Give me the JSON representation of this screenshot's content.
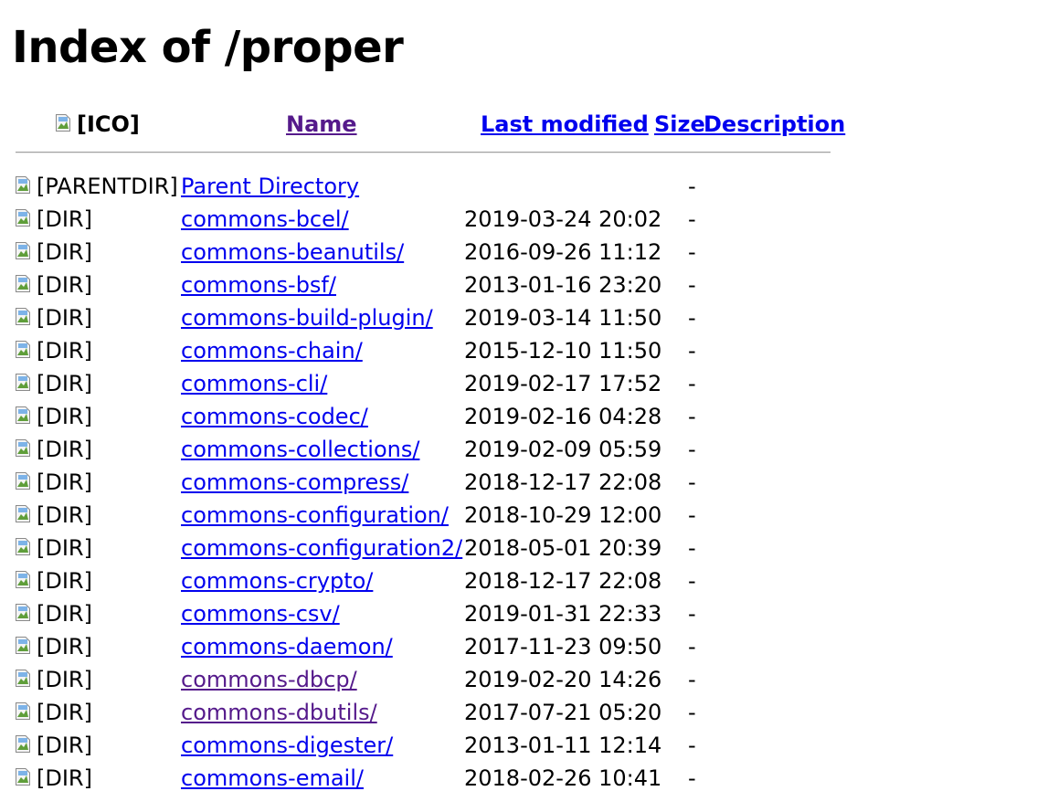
{
  "page_title": "Index of /proper",
  "columns": {
    "icon": "[ICO]",
    "name": "Name",
    "last_modified": "Last modified",
    "size": "Size",
    "description": "Description"
  },
  "entries": [
    {
      "alt": "[PARENTDIR]",
      "name": "Parent Directory",
      "date": "",
      "size": "-",
      "visited": false
    },
    {
      "alt": "[DIR]",
      "name": "commons-bcel/",
      "date": "2019-03-24 20:02",
      "size": "-",
      "visited": false
    },
    {
      "alt": "[DIR]",
      "name": "commons-beanutils/",
      "date": "2016-09-26 11:12",
      "size": "-",
      "visited": false
    },
    {
      "alt": "[DIR]",
      "name": "commons-bsf/",
      "date": "2013-01-16 23:20",
      "size": "-",
      "visited": false
    },
    {
      "alt": "[DIR]",
      "name": "commons-build-plugin/",
      "date": "2019-03-14 11:50",
      "size": "-",
      "visited": false
    },
    {
      "alt": "[DIR]",
      "name": "commons-chain/",
      "date": "2015-12-10 11:50",
      "size": "-",
      "visited": false
    },
    {
      "alt": "[DIR]",
      "name": "commons-cli/",
      "date": "2019-02-17 17:52",
      "size": "-",
      "visited": false
    },
    {
      "alt": "[DIR]",
      "name": "commons-codec/",
      "date": "2019-02-16 04:28",
      "size": "-",
      "visited": false
    },
    {
      "alt": "[DIR]",
      "name": "commons-collections/",
      "date": "2019-02-09 05:59",
      "size": "-",
      "visited": false
    },
    {
      "alt": "[DIR]",
      "name": "commons-compress/",
      "date": "2018-12-17 22:08",
      "size": "-",
      "visited": false
    },
    {
      "alt": "[DIR]",
      "name": "commons-configuration/",
      "date": "2018-10-29 12:00",
      "size": "-",
      "visited": false
    },
    {
      "alt": "[DIR]",
      "name": "commons-configuration2/",
      "date": "2018-05-01 20:39",
      "size": "-",
      "visited": false
    },
    {
      "alt": "[DIR]",
      "name": "commons-crypto/",
      "date": "2018-12-17 22:08",
      "size": "-",
      "visited": false
    },
    {
      "alt": "[DIR]",
      "name": "commons-csv/",
      "date": "2019-01-31 22:33",
      "size": "-",
      "visited": false
    },
    {
      "alt": "[DIR]",
      "name": "commons-daemon/",
      "date": "2017-11-23 09:50",
      "size": "-",
      "visited": false
    },
    {
      "alt": "[DIR]",
      "name": "commons-dbcp/",
      "date": "2019-02-20 14:26",
      "size": "-",
      "visited": true
    },
    {
      "alt": "[DIR]",
      "name": "commons-dbutils/",
      "date": "2017-07-21 05:20",
      "size": "-",
      "visited": true
    },
    {
      "alt": "[DIR]",
      "name": "commons-digester/",
      "date": "2013-01-11 12:14",
      "size": "-",
      "visited": false
    },
    {
      "alt": "[DIR]",
      "name": "commons-email/",
      "date": "2018-02-26 10:41",
      "size": "-",
      "visited": false
    }
  ],
  "colors": {
    "link": "#0000ee",
    "visited_link": "#551a8b",
    "text": "#000000",
    "background": "#ffffff"
  }
}
